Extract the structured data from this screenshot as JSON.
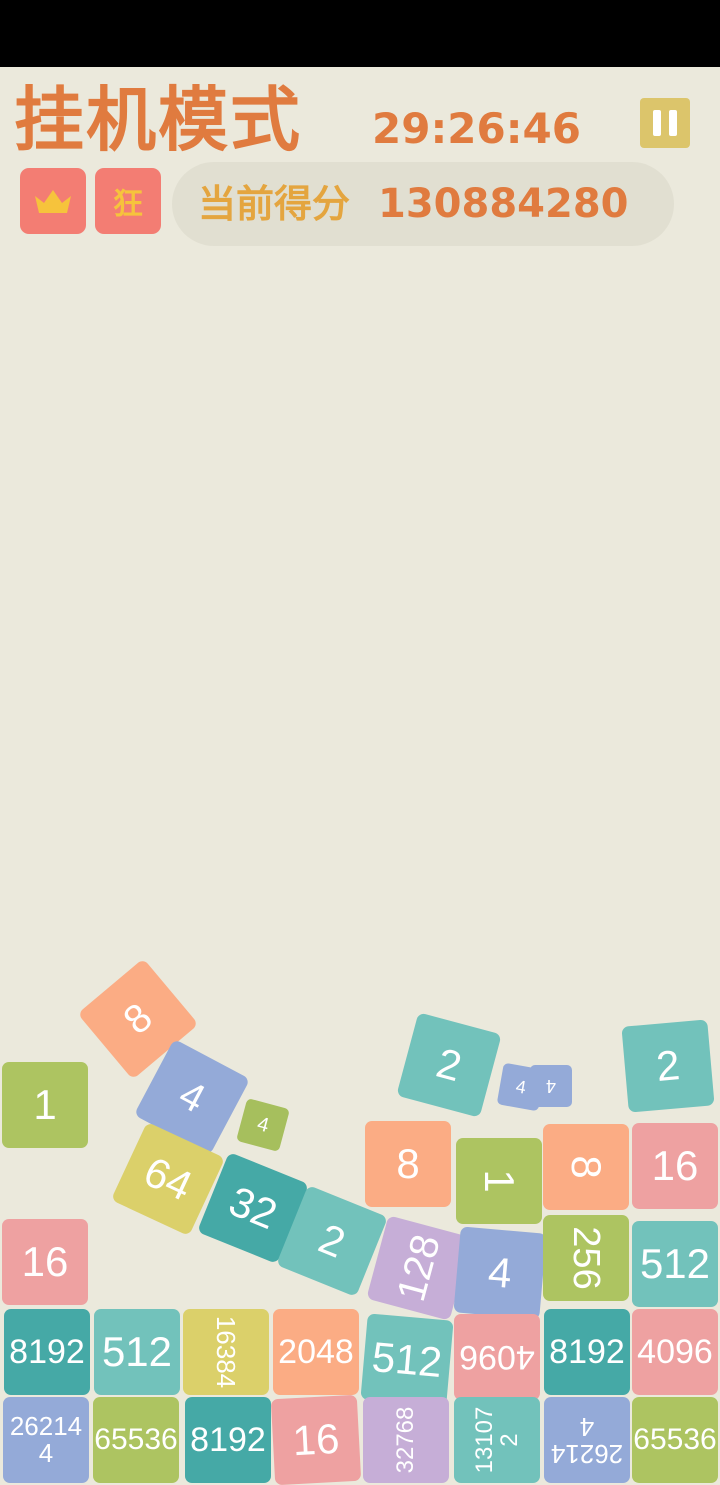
{
  "header": {
    "title": "挂机模式",
    "timer": "29:26:46",
    "score_label": "当前得分",
    "score_value": "130884280",
    "mad_badge": "狂"
  },
  "icons": {
    "pause": "pause-icon",
    "crown": "crown-icon"
  },
  "colors": {
    "background": "#ebe9dc",
    "title": "#e07b3f",
    "score_label": "#e4a53f",
    "badge": "#f37d73",
    "pause": "#dcc56b"
  },
  "tiles": [
    {
      "label": "1",
      "color": "#adc461"
    },
    {
      "label": "8",
      "color": "#fbac84"
    },
    {
      "label": "4",
      "color": "#94aad8"
    },
    {
      "label": "4",
      "color": "#a6bf5d"
    },
    {
      "label": "64",
      "color": "#dbd06a"
    },
    {
      "label": "32",
      "color": "#45a9a6"
    },
    {
      "label": "2",
      "color": "#72c2bb"
    },
    {
      "label": "2",
      "color": "#72c2bb"
    },
    {
      "label": "4",
      "color": "#94aad8"
    },
    {
      "label": "4",
      "color": "#94aad8"
    },
    {
      "label": "2",
      "color": "#72c2bb"
    },
    {
      "label": "8",
      "color": "#fbac84"
    },
    {
      "label": "1",
      "color": "#adc461"
    },
    {
      "label": "8",
      "color": "#fbac84"
    },
    {
      "label": "16",
      "color": "#eea1a1"
    },
    {
      "label": "16",
      "color": "#eea1a1"
    },
    {
      "label": "128",
      "color": "#c6aed7"
    },
    {
      "label": "4",
      "color": "#94aad8"
    },
    {
      "label": "256",
      "color": "#adc461"
    },
    {
      "label": "512",
      "color": "#72c2bb"
    },
    {
      "label": "8192",
      "color": "#45a9a6"
    },
    {
      "label": "512",
      "color": "#72c2bb"
    },
    {
      "label": "16384",
      "color": "#dbd06a"
    },
    {
      "label": "2048",
      "color": "#fbac84"
    },
    {
      "label": "512",
      "color": "#72c2bb"
    },
    {
      "label": "4096",
      "color": "#eea1a1"
    },
    {
      "label": "8192",
      "color": "#45a9a6"
    },
    {
      "label": "4096",
      "color": "#eea1a1"
    },
    {
      "label": "262144",
      "color": "#94aad8"
    },
    {
      "label": "65536",
      "color": "#adc461"
    },
    {
      "label": "8192",
      "color": "#45a9a6"
    },
    {
      "label": "16",
      "color": "#eea1a1"
    },
    {
      "label": "32768",
      "color": "#c6aed7"
    },
    {
      "label": "131072",
      "color": "#72c2bb"
    },
    {
      "label": "262144",
      "color": "#94aad8"
    },
    {
      "label": "65536",
      "color": "#adc461"
    }
  ]
}
